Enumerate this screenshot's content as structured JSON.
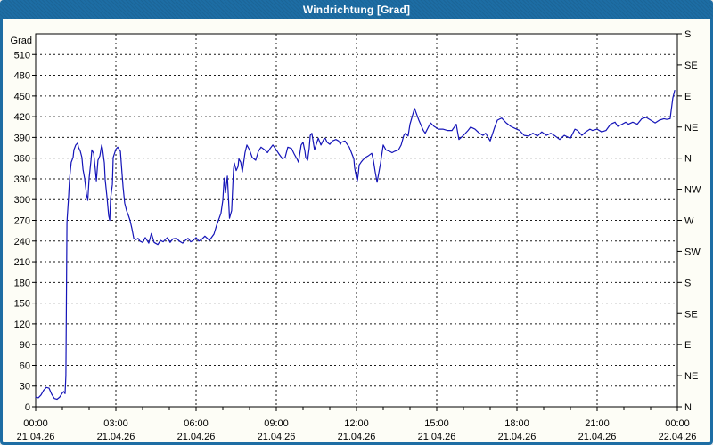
{
  "window": {
    "title": "Windrichtung [Grad]"
  },
  "colors": {
    "titlebar": "#1d6da4",
    "frame": "#1d6da4",
    "background": "#fdfdf6",
    "plot_background": "#ffffff",
    "grid": "#1a1a1a",
    "axis": "#000000",
    "line": "#1414b8",
    "title_text": "#ffffff"
  },
  "chart_data": {
    "type": "line",
    "title": "Windrichtung [Grad]",
    "ylabel": "Grad",
    "unit": "Grad",
    "grid": "dashed",
    "legend_position": "none",
    "ylim": [
      0,
      540
    ],
    "y_tick_step": 30,
    "y_ticks": [
      0,
      30,
      60,
      90,
      120,
      150,
      180,
      210,
      240,
      270,
      300,
      330,
      360,
      390,
      420,
      450,
      480,
      510
    ],
    "right_axis": {
      "tick_step_deg": 45,
      "labels_bottom_to_top": [
        "N",
        "NE",
        "E",
        "SE",
        "S",
        "SW",
        "W",
        "NW",
        "N",
        "NE",
        "E",
        "SE",
        "S"
      ]
    },
    "x_hours": [
      0,
      24
    ],
    "x_minor_tick_hours": 1,
    "x_major_ticks": [
      {
        "hour": 0,
        "time": "00:00",
        "date": "21.04.26"
      },
      {
        "hour": 3,
        "time": "03:00",
        "date": "21.04.26"
      },
      {
        "hour": 6,
        "time": "06:00",
        "date": "21.04.26"
      },
      {
        "hour": 9,
        "time": "09:00",
        "date": "21.04.26"
      },
      {
        "hour": 12,
        "time": "12:00",
        "date": "21.04.26"
      },
      {
        "hour": 15,
        "time": "15:00",
        "date": "21.04.26"
      },
      {
        "hour": 18,
        "time": "18:00",
        "date": "21.04.26"
      },
      {
        "hour": 21,
        "time": "21:00",
        "date": "21.04.26"
      },
      {
        "hour": 24,
        "time": "00:00",
        "date": "22.04.26"
      }
    ],
    "series": [
      {
        "name": "Windrichtung",
        "color": "#1414b8",
        "points": [
          [
            0,
            14
          ],
          [
            0.1,
            13
          ],
          [
            0.2,
            17
          ],
          [
            0.3,
            24
          ],
          [
            0.4,
            28
          ],
          [
            0.5,
            27
          ],
          [
            0.6,
            18
          ],
          [
            0.7,
            12
          ],
          [
            0.8,
            11
          ],
          [
            0.9,
            14
          ],
          [
            1.0,
            20
          ],
          [
            1.05,
            22
          ],
          [
            1.1,
            19
          ],
          [
            1.13,
            45
          ],
          [
            1.17,
            267
          ],
          [
            1.23,
            303
          ],
          [
            1.27,
            331
          ],
          [
            1.33,
            354
          ],
          [
            1.4,
            361
          ],
          [
            1.43,
            372
          ],
          [
            1.5,
            379
          ],
          [
            1.57,
            382
          ],
          [
            1.6,
            376
          ],
          [
            1.67,
            370
          ],
          [
            1.73,
            361
          ],
          [
            1.77,
            344
          ],
          [
            1.83,
            331
          ],
          [
            1.9,
            308
          ],
          [
            1.95,
            299
          ],
          [
            2.0,
            331
          ],
          [
            2.07,
            357
          ],
          [
            2.1,
            372
          ],
          [
            2.17,
            367
          ],
          [
            2.23,
            344
          ],
          [
            2.27,
            327
          ],
          [
            2.33,
            357
          ],
          [
            2.4,
            363
          ],
          [
            2.47,
            379
          ],
          [
            2.5,
            374
          ],
          [
            2.57,
            353
          ],
          [
            2.6,
            329
          ],
          [
            2.67,
            303
          ],
          [
            2.73,
            277
          ],
          [
            2.77,
            270
          ],
          [
            2.8,
            301
          ],
          [
            2.87,
            322
          ],
          [
            2.9,
            361
          ],
          [
            3.0,
            373
          ],
          [
            3.07,
            376
          ],
          [
            3.17,
            370
          ],
          [
            3.23,
            338
          ],
          [
            3.27,
            318
          ],
          [
            3.33,
            295
          ],
          [
            3.4,
            284
          ],
          [
            3.47,
            277
          ],
          [
            3.53,
            270
          ],
          [
            3.6,
            258
          ],
          [
            3.67,
            244
          ],
          [
            3.75,
            242
          ],
          [
            3.83,
            244
          ],
          [
            3.9,
            240
          ],
          [
            4.0,
            238
          ],
          [
            4.1,
            245
          ],
          [
            4.23,
            237
          ],
          [
            4.33,
            251
          ],
          [
            4.43,
            238
          ],
          [
            4.57,
            235
          ],
          [
            4.67,
            241
          ],
          [
            4.77,
            239
          ],
          [
            4.87,
            243
          ],
          [
            4.93,
            245
          ],
          [
            5.03,
            238
          ],
          [
            5.13,
            243
          ],
          [
            5.27,
            244
          ],
          [
            5.37,
            240
          ],
          [
            5.5,
            237
          ],
          [
            5.6,
            241
          ],
          [
            5.7,
            244
          ],
          [
            5.8,
            239
          ],
          [
            5.9,
            241
          ],
          [
            6.0,
            245
          ],
          [
            6.1,
            240
          ],
          [
            6.2,
            242
          ],
          [
            6.33,
            247
          ],
          [
            6.5,
            241
          ],
          [
            6.67,
            250
          ],
          [
            6.77,
            263
          ],
          [
            6.93,
            280
          ],
          [
            7.0,
            299
          ],
          [
            7.05,
            331
          ],
          [
            7.1,
            310
          ],
          [
            7.17,
            334
          ],
          [
            7.25,
            273
          ],
          [
            7.33,
            284
          ],
          [
            7.4,
            344
          ],
          [
            7.43,
            353
          ],
          [
            7.5,
            342
          ],
          [
            7.57,
            348
          ],
          [
            7.6,
            359
          ],
          [
            7.67,
            354
          ],
          [
            7.73,
            340
          ],
          [
            7.83,
            368
          ],
          [
            7.9,
            379
          ],
          [
            8.0,
            372
          ],
          [
            8.1,
            361
          ],
          [
            8.23,
            357
          ],
          [
            8.33,
            370
          ],
          [
            8.43,
            376
          ],
          [
            8.57,
            372
          ],
          [
            8.67,
            368
          ],
          [
            8.77,
            374
          ],
          [
            8.87,
            379
          ],
          [
            8.93,
            376
          ],
          [
            9.0,
            372
          ],
          [
            9.1,
            366
          ],
          [
            9.23,
            359
          ],
          [
            9.33,
            361
          ],
          [
            9.43,
            376
          ],
          [
            9.57,
            374
          ],
          [
            9.67,
            366
          ],
          [
            9.77,
            359
          ],
          [
            9.83,
            354
          ],
          [
            9.93,
            379
          ],
          [
            10.0,
            383
          ],
          [
            10.07,
            370
          ],
          [
            10.1,
            361
          ],
          [
            10.17,
            357
          ],
          [
            10.23,
            374
          ],
          [
            10.27,
            393
          ],
          [
            10.33,
            396
          ],
          [
            10.4,
            379
          ],
          [
            10.43,
            372
          ],
          [
            10.57,
            389
          ],
          [
            10.67,
            379
          ],
          [
            10.77,
            387
          ],
          [
            10.83,
            389
          ],
          [
            10.9,
            383
          ],
          [
            11.0,
            380
          ],
          [
            11.1,
            385
          ],
          [
            11.23,
            387
          ],
          [
            11.33,
            385
          ],
          [
            11.4,
            380
          ],
          [
            11.43,
            383
          ],
          [
            11.57,
            385
          ],
          [
            11.6,
            383
          ],
          [
            11.67,
            379
          ],
          [
            11.73,
            376
          ],
          [
            11.77,
            372
          ],
          [
            11.83,
            366
          ],
          [
            11.9,
            359
          ],
          [
            11.93,
            346
          ],
          [
            12.0,
            331
          ],
          [
            12.03,
            327
          ],
          [
            12.07,
            338
          ],
          [
            12.1,
            350
          ],
          [
            12.17,
            354
          ],
          [
            12.23,
            357
          ],
          [
            12.33,
            361
          ],
          [
            12.43,
            363
          ],
          [
            12.57,
            367
          ],
          [
            12.63,
            357
          ],
          [
            12.7,
            340
          ],
          [
            12.77,
            325
          ],
          [
            12.9,
            353
          ],
          [
            13.0,
            379
          ],
          [
            13.1,
            372
          ],
          [
            13.23,
            370
          ],
          [
            13.33,
            368
          ],
          [
            13.43,
            370
          ],
          [
            13.57,
            372
          ],
          [
            13.67,
            379
          ],
          [
            13.77,
            393
          ],
          [
            13.83,
            396
          ],
          [
            13.93,
            392
          ],
          [
            14.0,
            409
          ],
          [
            14.17,
            432
          ],
          [
            14.33,
            415
          ],
          [
            14.5,
            400
          ],
          [
            14.57,
            396
          ],
          [
            14.77,
            411
          ],
          [
            14.9,
            406
          ],
          [
            15.07,
            402
          ],
          [
            15.23,
            402
          ],
          [
            15.4,
            400
          ],
          [
            15.57,
            400
          ],
          [
            15.73,
            409
          ],
          [
            15.83,
            387
          ],
          [
            16.0,
            393
          ],
          [
            16.17,
            400
          ],
          [
            16.27,
            405
          ],
          [
            16.43,
            402
          ],
          [
            16.57,
            397
          ],
          [
            16.73,
            393
          ],
          [
            16.83,
            396
          ],
          [
            17.0,
            385
          ],
          [
            17.17,
            405
          ],
          [
            17.27,
            415
          ],
          [
            17.43,
            418
          ],
          [
            17.6,
            411
          ],
          [
            17.77,
            406
          ],
          [
            17.93,
            403
          ],
          [
            18.1,
            400
          ],
          [
            18.27,
            393
          ],
          [
            18.43,
            392
          ],
          [
            18.6,
            396
          ],
          [
            18.77,
            392
          ],
          [
            18.93,
            398
          ],
          [
            19.1,
            393
          ],
          [
            19.27,
            396
          ],
          [
            19.43,
            392
          ],
          [
            19.6,
            387
          ],
          [
            19.77,
            393
          ],
          [
            19.93,
            390
          ],
          [
            20.0,
            389
          ],
          [
            20.17,
            402
          ],
          [
            20.27,
            400
          ],
          [
            20.43,
            393
          ],
          [
            20.57,
            398
          ],
          [
            20.73,
            402
          ],
          [
            20.83,
            400
          ],
          [
            21.0,
            402
          ],
          [
            21.17,
            398
          ],
          [
            21.33,
            400
          ],
          [
            21.5,
            409
          ],
          [
            21.67,
            412
          ],
          [
            21.77,
            406
          ],
          [
            21.93,
            409
          ],
          [
            22.07,
            412
          ],
          [
            22.17,
            409
          ],
          [
            22.33,
            412
          ],
          [
            22.5,
            409
          ],
          [
            22.67,
            417
          ],
          [
            22.83,
            419
          ],
          [
            23.0,
            415
          ],
          [
            23.17,
            411
          ],
          [
            23.33,
            415
          ],
          [
            23.5,
            417
          ],
          [
            23.6,
            416
          ],
          [
            23.73,
            417
          ],
          [
            23.83,
            447
          ],
          [
            23.9,
            458
          ]
        ]
      }
    ]
  }
}
